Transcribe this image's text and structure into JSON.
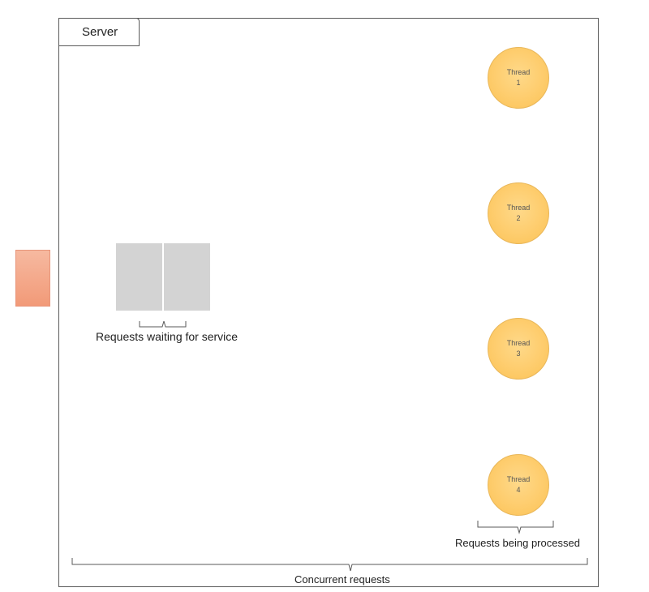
{
  "server": {
    "label": "Server"
  },
  "queue": {
    "label": "Requests waiting for service",
    "pending_count": 2
  },
  "threads": [
    {
      "word": "Thread",
      "number": "1"
    },
    {
      "word": "Thread",
      "number": "2"
    },
    {
      "word": "Thread",
      "number": "3"
    },
    {
      "word": "Thread",
      "number": "4"
    }
  ],
  "processing": {
    "label": "Requests being processed"
  },
  "concurrent": {
    "label": "Concurrent requests"
  },
  "colors": {
    "thread_fill": "#fdc965",
    "incoming_request": "#f29a78",
    "queued_request": "#d3d3d3",
    "border": "#5a5a5a"
  }
}
